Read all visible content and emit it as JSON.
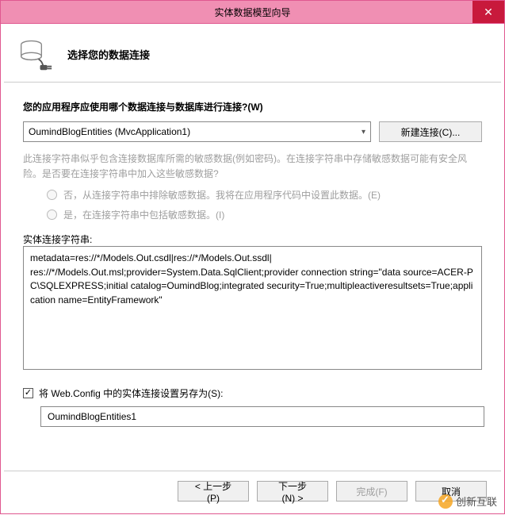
{
  "titlebar": {
    "title": "实体数据模型向导"
  },
  "header": {
    "subtitle": "选择您的数据连接"
  },
  "prompt": "您的应用程序应使用哪个数据连接与数据库进行连接?(W)",
  "connection": {
    "selected": "OumindBlogEntities (MvcApplication1)",
    "new_button": "新建连接(C)..."
  },
  "warning": "此连接字符串似乎包含连接数据库所需的敏感数据(例如密码)。在连接字符串中存储敏感数据可能有安全风险。是否要在连接字符串中加入这些敏感数据?",
  "radios": {
    "opt_no": "否，从连接字符串中排除敏感数据。我将在应用程序代码中设置此数据。(E)",
    "opt_yes": "是，在连接字符串中包括敏感数据。(I)"
  },
  "conn_string": {
    "label": "实体连接字符串:",
    "value": "metadata=res://*/Models.Out.csdl|res://*/Models.Out.ssdl|\nres://*/Models.Out.msl;provider=System.Data.SqlClient;provider connection string=\"data source=ACER-PC\\SQLEXPRESS;initial catalog=OumindBlog;integrated security=True;multipleactiveresultsets=True;application name=EntityFramework\""
  },
  "save_as": {
    "checkbox_label": "将 Web.Config 中的实体连接设置另存为(S):",
    "value": "OumindBlogEntities1"
  },
  "footer": {
    "prev": "< 上一步(P)",
    "next": "下一步(N) >",
    "finish": "完成(F)",
    "cancel": "取消"
  },
  "watermark": "创新互联"
}
